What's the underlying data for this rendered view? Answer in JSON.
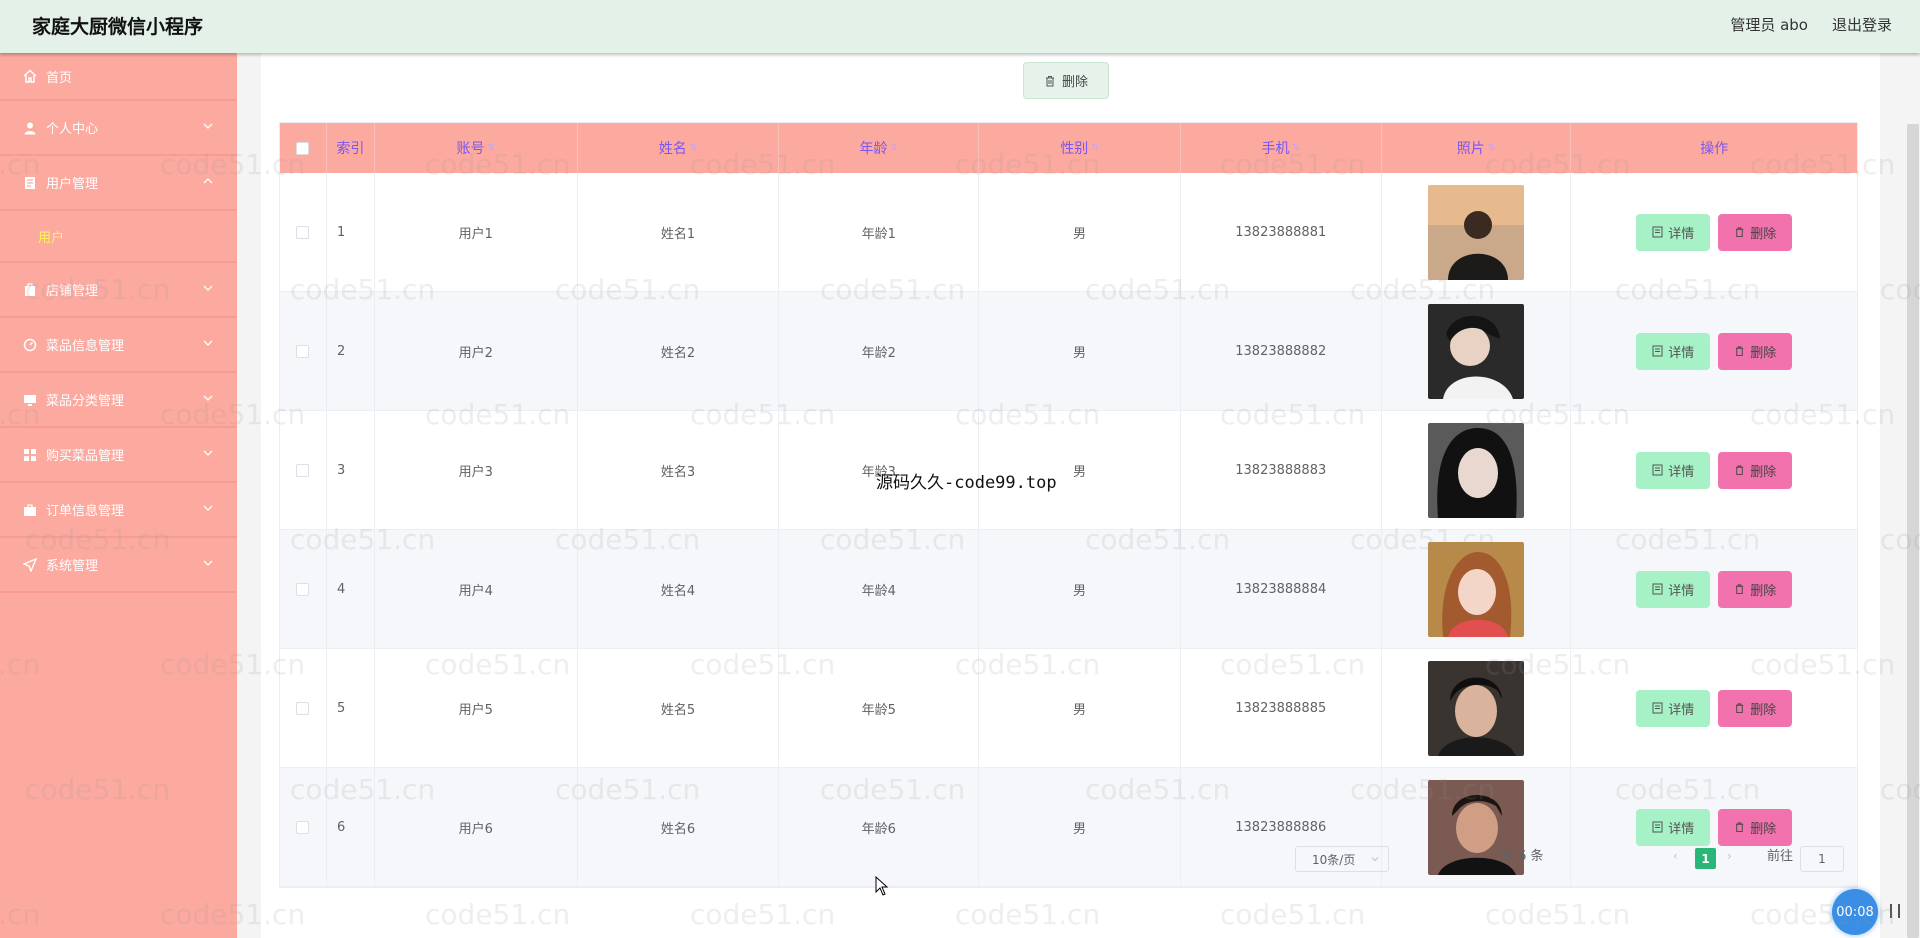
{
  "app": {
    "title": "家庭大厨微信小程序"
  },
  "header": {
    "admin_label": "管理员 abo",
    "logout_label": "退出登录"
  },
  "sidebar": {
    "items": [
      {
        "label": "首页",
        "icon": "home-icon"
      },
      {
        "label": "个人中心",
        "icon": "user-icon",
        "expandable": true
      },
      {
        "label": "用户管理",
        "icon": "document-icon",
        "expanded": true,
        "children": [
          {
            "label": "用户"
          }
        ]
      },
      {
        "label": "店铺管理",
        "icon": "shop-icon",
        "expandable": true
      },
      {
        "label": "菜品信息管理",
        "icon": "dish-icon",
        "expandable": true
      },
      {
        "label": "菜品分类管理",
        "icon": "monitor-icon",
        "expandable": true
      },
      {
        "label": "购买菜品管理",
        "icon": "grid-icon",
        "expandable": true
      },
      {
        "label": "订单信息管理",
        "icon": "briefcase-icon",
        "expandable": true
      },
      {
        "label": "系统管理",
        "icon": "navigation-icon",
        "expandable": true
      }
    ]
  },
  "toolbar": {
    "delete_label": "删除"
  },
  "table": {
    "headers": [
      "索引",
      "账号",
      "姓名",
      "年龄",
      "性别",
      "手机",
      "照片",
      "操作"
    ],
    "rows": [
      {
        "index": "1",
        "account": "用户1",
        "name": "姓名1",
        "age": "年龄1",
        "gender": "男",
        "phone": "13823888881"
      },
      {
        "index": "2",
        "account": "用户2",
        "name": "姓名2",
        "age": "年龄2",
        "gender": "男",
        "phone": "13823888882"
      },
      {
        "index": "3",
        "account": "用户3",
        "name": "姓名3",
        "age": "年龄3",
        "gender": "男",
        "phone": "13823888883"
      },
      {
        "index": "4",
        "account": "用户4",
        "name": "姓名4",
        "age": "年龄4",
        "gender": "男",
        "phone": "13823888884"
      },
      {
        "index": "5",
        "account": "用户5",
        "name": "姓名5",
        "age": "年龄5",
        "gender": "男",
        "phone": "13823888885"
      },
      {
        "index": "6",
        "account": "用户6",
        "name": "姓名6",
        "age": "年龄6",
        "gender": "男",
        "phone": "13823888886"
      }
    ],
    "detail_label": "详情",
    "delete_label": "删除"
  },
  "pagination": {
    "total": "共 6 条",
    "page_size": "10条/页",
    "current": "1",
    "goto_label": "前往",
    "goto_value": "1"
  },
  "overlay": {
    "timer": "00:08",
    "watermark_center": "源码久久-code99.top",
    "watermark_tile": "code51.cn"
  },
  "colors": {
    "header_bg": "#e3f1e9",
    "sidebar_bg": "#fcaaa0",
    "table_head_bg": "#fcaaa0",
    "detail_btn": "#a6f1c5",
    "delete_btn": "#f172ad",
    "active_page": "#29b677",
    "submenu_active": "#fff55c"
  }
}
